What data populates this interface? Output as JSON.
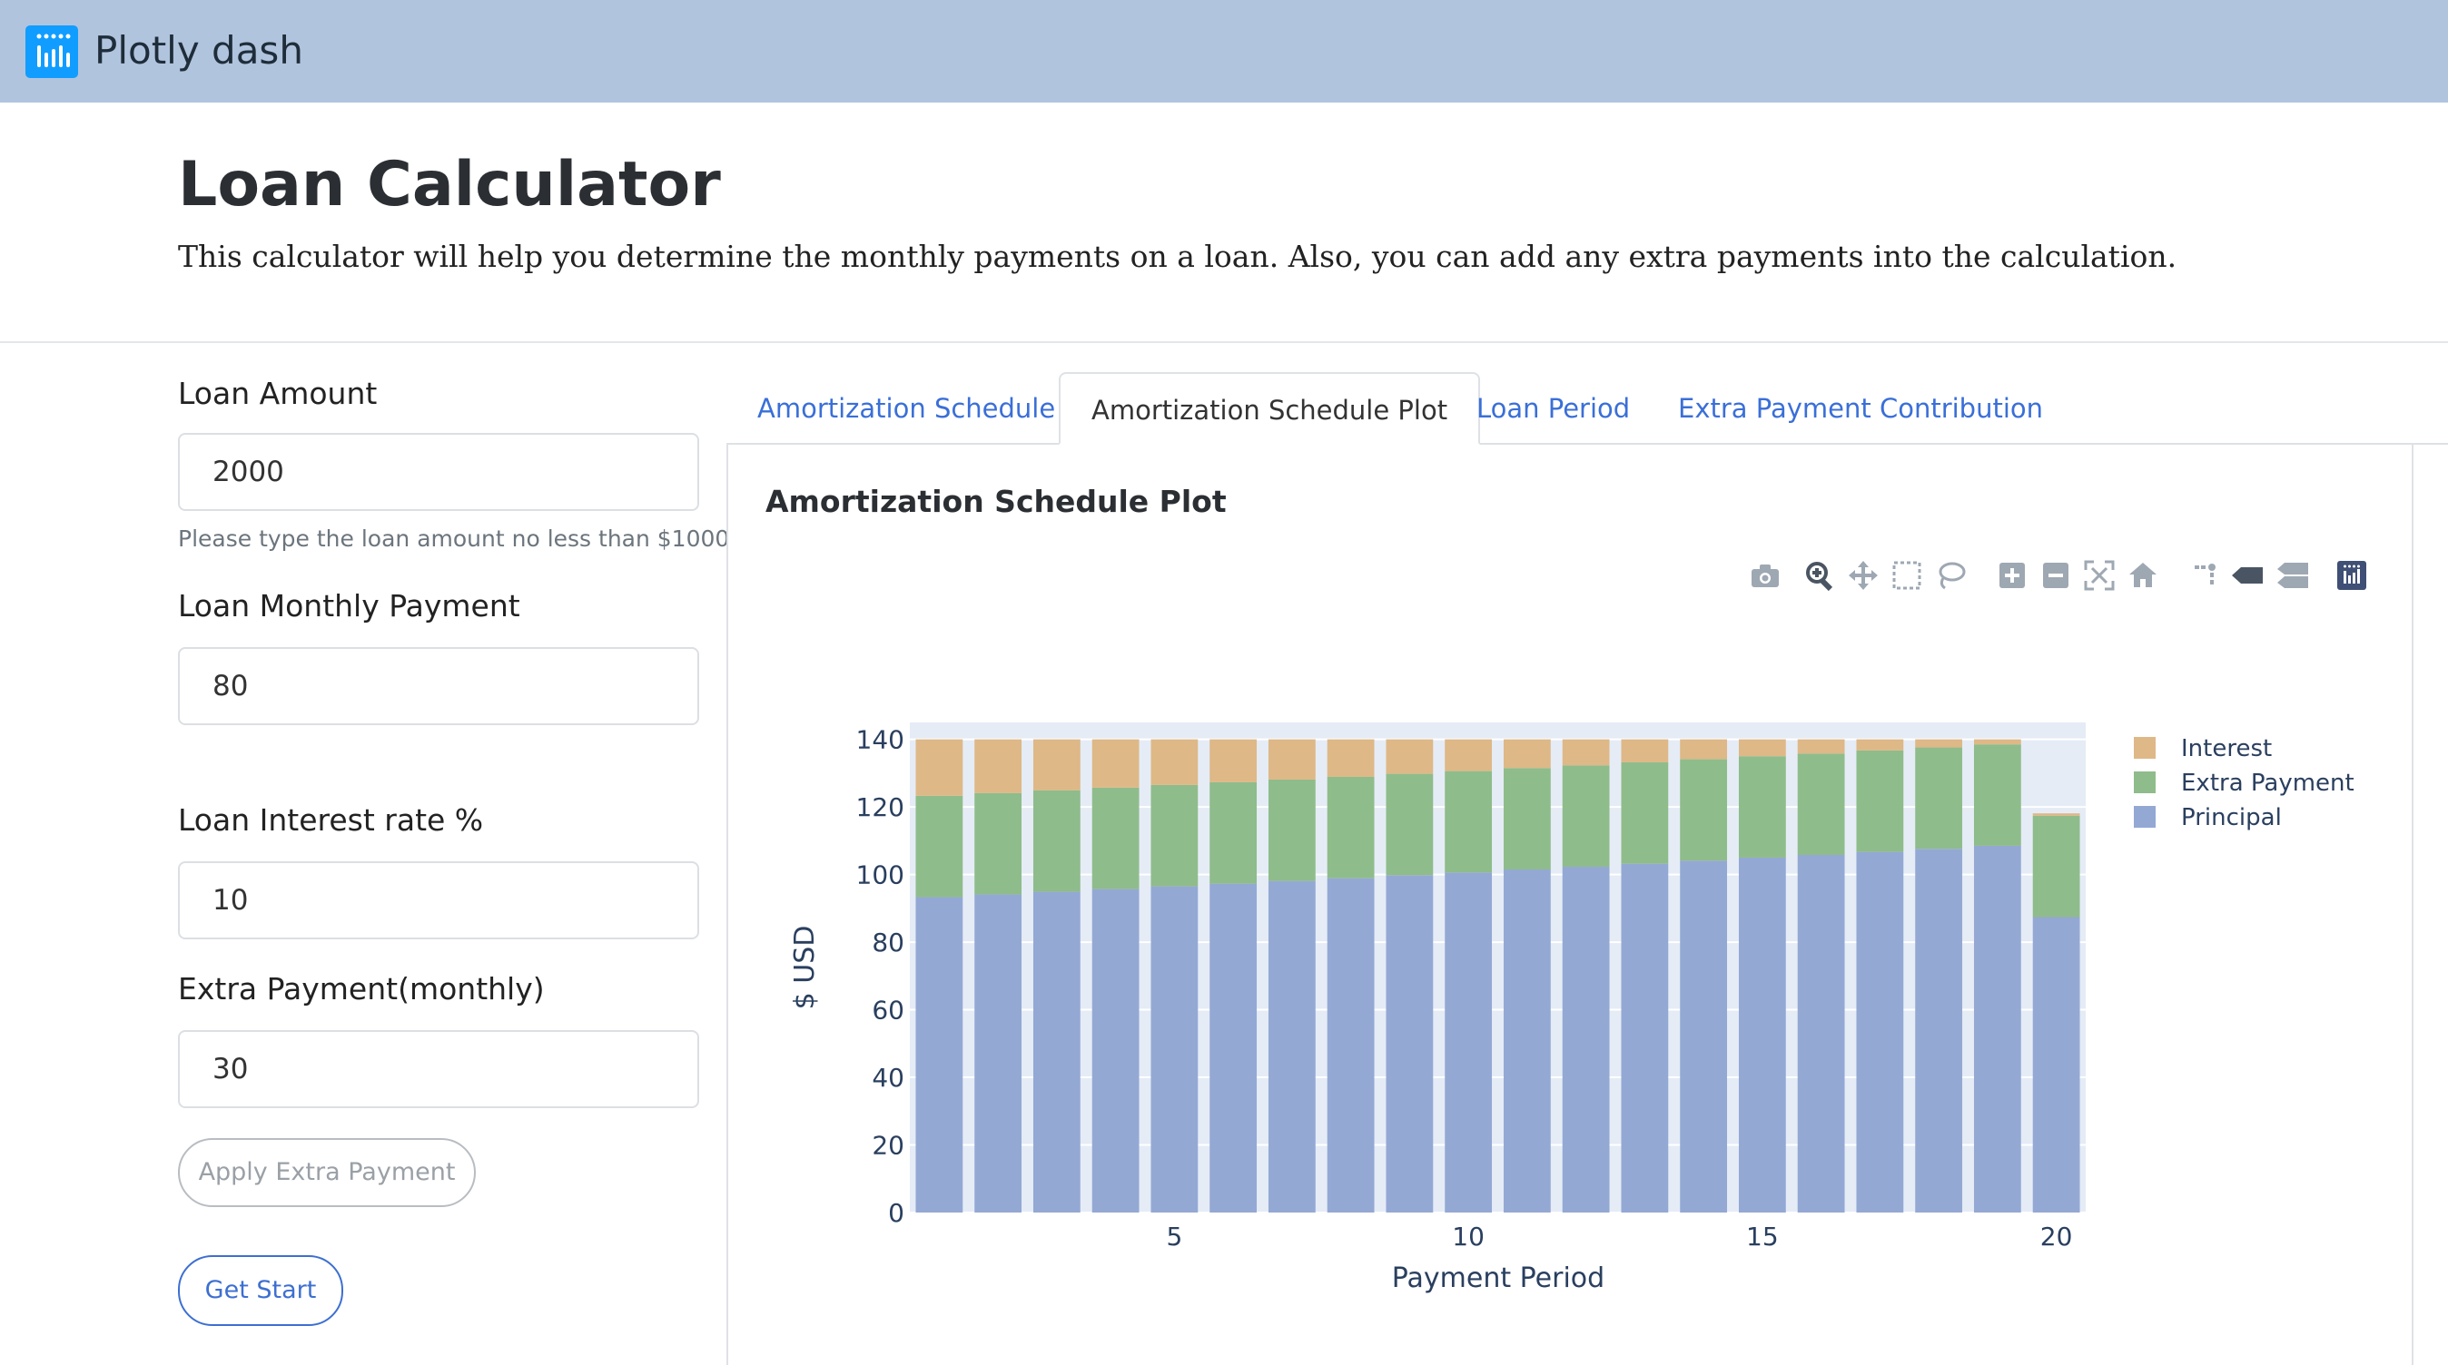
{
  "app": {
    "title": "Plotly dash"
  },
  "page": {
    "heading": "Loan Calculator",
    "subheading": "This calculator will help you determine the monthly payments on a loan. Also, you can add any extra payments into the calculation."
  },
  "form": {
    "loan_amount_label": "Loan Amount",
    "loan_amount_value": "2000",
    "loan_amount_help": "Please type the loan amount no less than $1000",
    "monthly_payment_label": "Loan Monthly Payment",
    "monthly_payment_value": "80",
    "interest_label": "Loan Interest rate %",
    "interest_value": "10",
    "extra_label": "Extra Payment(monthly)",
    "extra_value": "30",
    "apply_button": "Apply Extra Payment",
    "start_button": "Get Start"
  },
  "tabs": [
    {
      "label": "Amortization Schedule",
      "active": false
    },
    {
      "label": "Amortization Schedule Plot",
      "active": true
    },
    {
      "label": "Loan Period",
      "active": false
    },
    {
      "label": "Extra Payment Contribution",
      "active": false
    }
  ],
  "panel": {
    "title": "Amortization Schedule Plot"
  },
  "modebar": [
    "camera-icon",
    "zoom-icon",
    "pan-icon",
    "box-select-icon",
    "lasso-select-icon",
    "zoom-in-icon",
    "zoom-out-icon",
    "autoscale-icon",
    "reset-axes-icon",
    "spike-lines-icon",
    "hover-closest-icon",
    "hover-compare-icon",
    "plotly-logo-icon"
  ],
  "chart_data": {
    "type": "bar",
    "barmode": "stack",
    "xlabel": "Payment Period",
    "ylabel": "$ USD",
    "ylim": [
      0,
      145
    ],
    "xlim": [
      0.5,
      20.5
    ],
    "yticks": [
      0,
      20,
      40,
      60,
      80,
      100,
      120,
      140
    ],
    "xticks": [
      5,
      10,
      15,
      20
    ],
    "legend_position": "top-right",
    "x": [
      1,
      2,
      3,
      4,
      5,
      6,
      7,
      8,
      9,
      10,
      11,
      12,
      13,
      14,
      15,
      16,
      17,
      18,
      19,
      20
    ],
    "series": [
      {
        "name": "Principal",
        "color": "#94a8d4",
        "values": [
          93.3,
          94.1,
          94.9,
          95.7,
          96.5,
          97.3,
          98.1,
          98.9,
          99.8,
          100.6,
          101.5,
          102.3,
          103.2,
          104.1,
          105.0,
          105.8,
          106.7,
          107.6,
          108.5,
          87.4
        ]
      },
      {
        "name": "Extra Payment",
        "color": "#8fbc8b",
        "values": [
          30,
          30,
          30,
          30,
          30,
          30,
          30,
          30,
          30,
          30,
          30,
          30,
          30,
          30,
          30,
          30,
          30,
          30,
          30,
          30
        ]
      },
      {
        "name": "Interest",
        "color": "#deb887",
        "values": [
          16.7,
          15.9,
          15.1,
          14.3,
          13.5,
          12.7,
          11.9,
          11.1,
          10.2,
          9.4,
          8.5,
          7.7,
          6.8,
          5.9,
          5.0,
          4.2,
          3.3,
          2.4,
          1.5,
          0.7
        ]
      }
    ]
  }
}
